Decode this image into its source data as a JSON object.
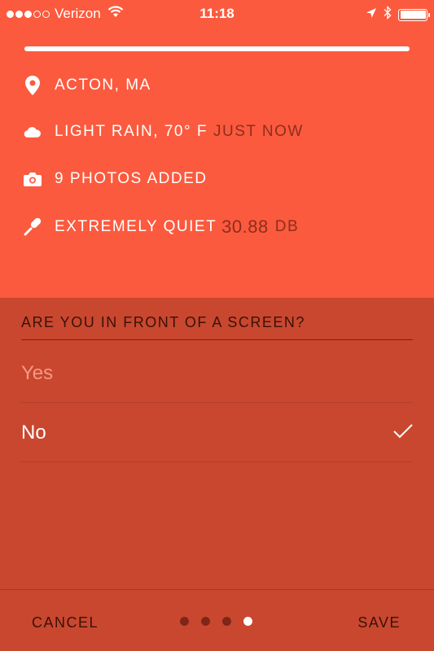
{
  "status_bar": {
    "carrier": "Verizon",
    "time": "11:18",
    "signal_bars_filled": 3,
    "signal_bars_total": 5
  },
  "progress": {
    "fraction": 1.0
  },
  "info": {
    "location": "ACTON, MA",
    "weather": "LIGHT RAIN, 70° F",
    "weather_time": "JUST NOW",
    "photos": "9 PHOTOS ADDED",
    "noise_label": "EXTREMELY QUIET",
    "noise_value": "30.88",
    "noise_unit": "DB"
  },
  "question": {
    "title": "ARE YOU IN FRONT OF A SCREEN?",
    "options": [
      {
        "label": "Yes",
        "selected": false
      },
      {
        "label": "No",
        "selected": true
      }
    ]
  },
  "footer": {
    "cancel_label": "CANCEL",
    "save_label": "SAVE",
    "pages_total": 4,
    "current_page": 4
  },
  "colors": {
    "top_background": "#fb5a3e",
    "bottom_background": "#c9472f",
    "dark_text": "#3a1208"
  }
}
